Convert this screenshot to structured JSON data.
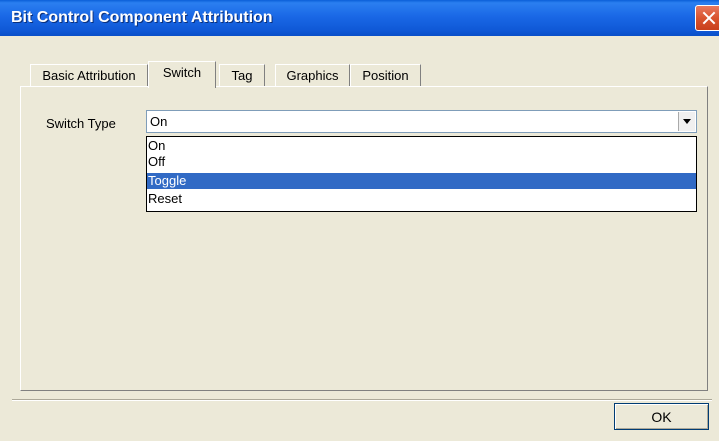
{
  "window": {
    "title": "Bit Control Component Attribution",
    "close_icon": "close-icon"
  },
  "tabs": [
    {
      "label": "Basic Attribution",
      "active": false
    },
    {
      "label": "Switch",
      "active": true
    },
    {
      "label": "Tag",
      "active": false
    },
    {
      "label": "Graphics",
      "active": false
    },
    {
      "label": "Position",
      "active": false
    }
  ],
  "switch_type": {
    "label": "Switch Type",
    "value": "On",
    "options": [
      "On",
      "Off",
      "Toggle",
      "Reset"
    ],
    "highlighted": "Toggle",
    "arrow_icon": "chevron-down-icon"
  },
  "buttons": {
    "ok": "OK"
  },
  "colors": {
    "titlebar": "#0a5fd8",
    "selection": "#316ac5",
    "close_button": "#d9542f"
  }
}
